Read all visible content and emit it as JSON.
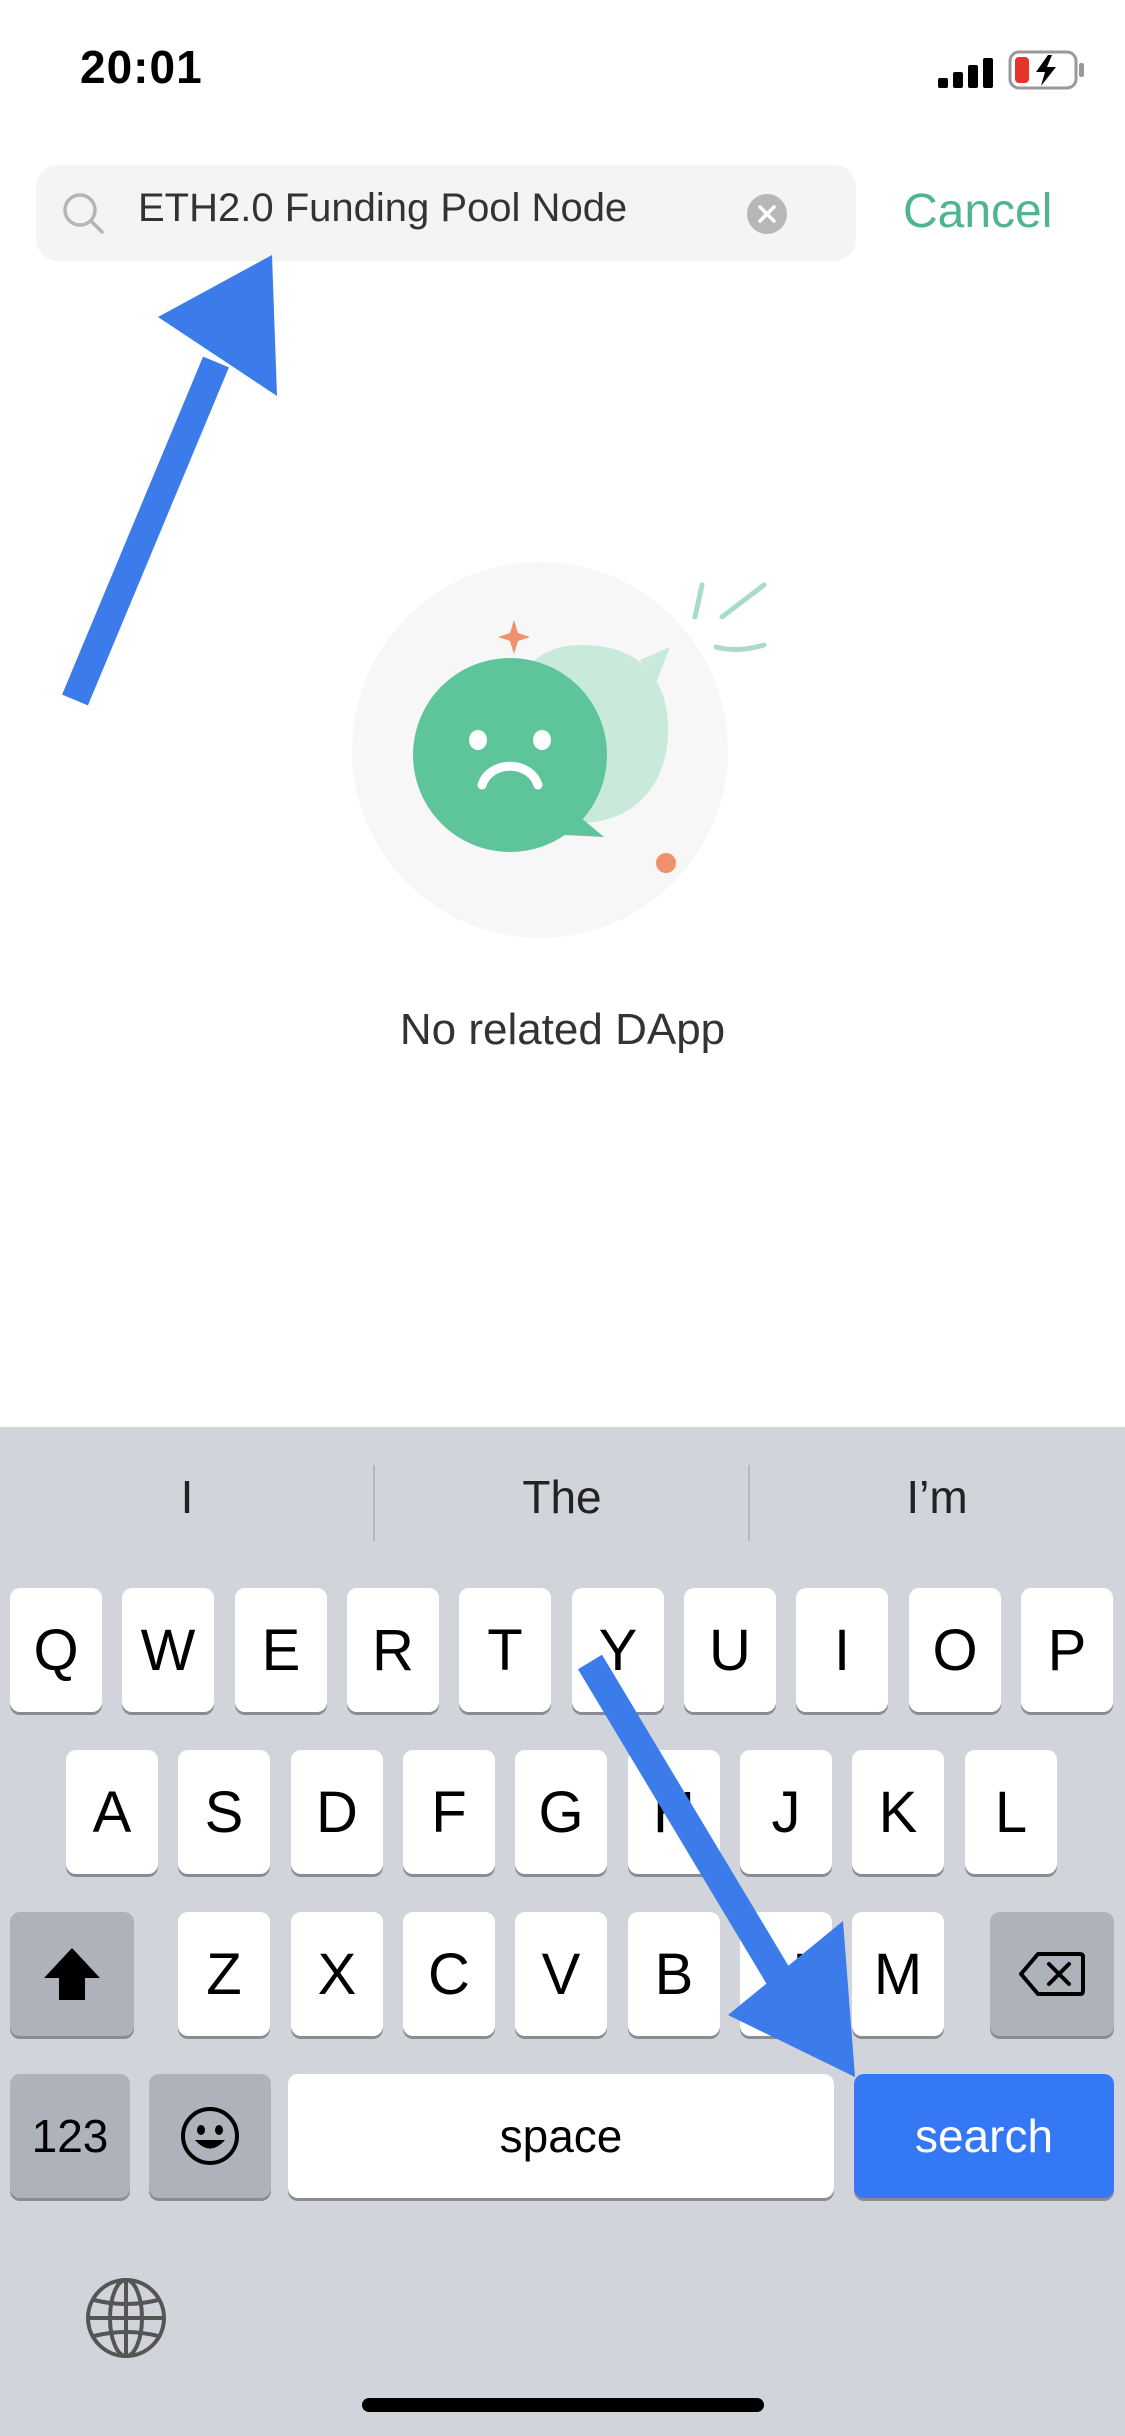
{
  "status_bar": {
    "time": "20:01"
  },
  "search": {
    "query": "ETH2.0 Funding Pool Node",
    "cancel_label": "Cancel"
  },
  "empty_state": {
    "message": "No related DApp"
  },
  "keyboard": {
    "suggestions": [
      "I",
      "The",
      "I’m"
    ],
    "row1": [
      "Q",
      "W",
      "E",
      "R",
      "T",
      "Y",
      "U",
      "I",
      "O",
      "P"
    ],
    "row2": [
      "A",
      "S",
      "D",
      "F",
      "G",
      "H",
      "J",
      "K",
      "L"
    ],
    "row3": [
      "Z",
      "X",
      "C",
      "V",
      "B",
      "N",
      "M"
    ],
    "numbers_label": "123",
    "space_label": "space",
    "search_label": "search"
  },
  "colors": {
    "accent": "#4fb58d",
    "keyboard_bg": "#d2d4db",
    "search_key": "#3478f6",
    "annotation_arrow": "#3b7bea"
  }
}
